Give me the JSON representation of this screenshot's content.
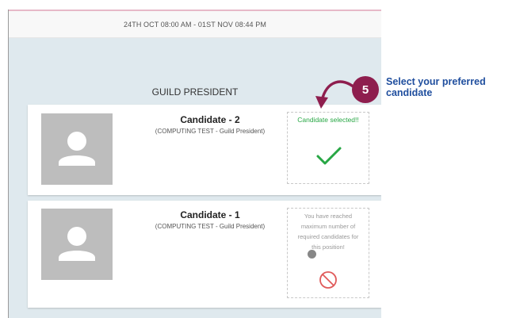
{
  "header": {
    "date_range": "24TH OCT 08:00 AM - 01ST NOV 08:44 PM"
  },
  "position": {
    "title": "GUILD PRESIDENT"
  },
  "candidates": [
    {
      "name": "Candidate - 2",
      "description": "(COMPUTING TEST - Guild President)",
      "status_text": "Candidate selected!!",
      "status_icon": "checkmark-icon"
    },
    {
      "name": "Candidate - 1",
      "description": "(COMPUTING TEST - Guild President)",
      "status_text": "You have reached maximum number of required candidates for this position!",
      "status_icon": "prohibited-icon"
    }
  ],
  "annotation": {
    "step_number": "5",
    "text": "Select your preferred candidate"
  },
  "colors": {
    "accent": "#8e1e4e",
    "instruction_text": "#1f4e9e",
    "selected_green": "#28a745",
    "forbidden_red": "#e05a5a",
    "panel_bg": "#dfe9ee"
  }
}
